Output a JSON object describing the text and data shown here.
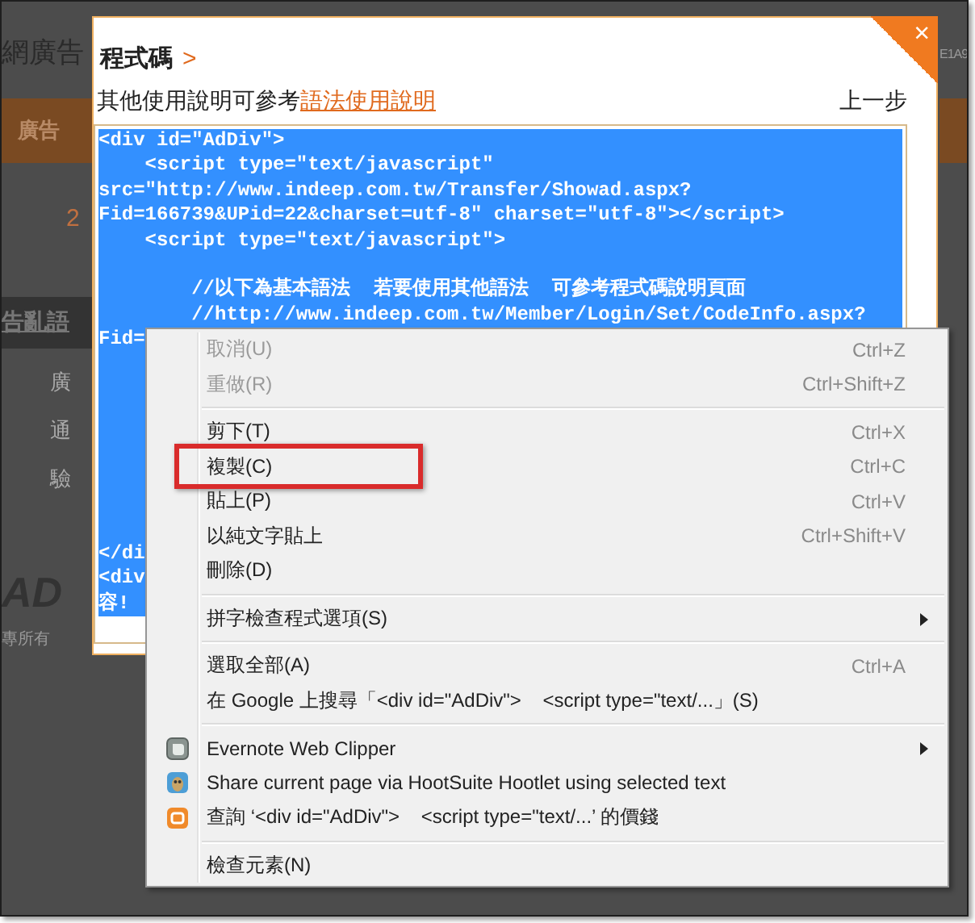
{
  "background_page": {
    "left": [
      {
        "kind": "heading",
        "text": "網廣告"
      },
      {
        "kind": "bar",
        "text": "廣告"
      },
      {
        "kind": "number",
        "text": "2"
      },
      {
        "kind": "tab",
        "text": "告亂語"
      },
      {
        "kind": "item",
        "text": "廣"
      },
      {
        "kind": "item",
        "text": "通"
      },
      {
        "kind": "item",
        "text": "驗"
      },
      {
        "kind": "logo",
        "text": "AD"
      },
      {
        "kind": "footer",
        "text": "專所有"
      }
    ],
    "right": [
      {
        "kind": "heading",
        "text": "E1A9"
      },
      {
        "kind": "bar"
      }
    ]
  },
  "dialog": {
    "title": "程式碼",
    "title_mark": ">",
    "hint": "其他使用說明可參考",
    "hint_link": "語法使用說明",
    "back": "上一步",
    "close": "×",
    "code": {
      "selected": true,
      "blocks": [
        [
          "<div id=\"AdDiv\">",
          "    <script type=\"text/javascript\"",
          "src=\"http://www.indeep.com.tw/Transfer/Showad.aspx?",
          "Fid=166739&UPid=22&charset=utf-8\" charset=\"utf-8\"></script>",
          "    <script type=\"text/javascript\">"
        ],
        [
          "        //以下為基本語法  若要使用其他語法  可參考程式碼說明頁面",
          "        //http://www.indeep.com.tw/Member/Login/Set/CodeInfo.aspx?",
          "Fid="
        ],
        [
          "</di",
          "<div",
          "容!"
        ]
      ]
    }
  },
  "context_menu": {
    "items": [
      {
        "kind": "item",
        "label": "取消(U)",
        "shortcut": "Ctrl+Z",
        "disabled": true
      },
      {
        "kind": "item",
        "label": "重做(R)",
        "shortcut": "Ctrl+Shift+Z",
        "disabled": true
      },
      {
        "kind": "separator"
      },
      {
        "kind": "item",
        "label": "剪下(T)",
        "shortcut": "Ctrl+X",
        "disabled": false
      },
      {
        "kind": "item",
        "label": "複製(C)",
        "shortcut": "Ctrl+C",
        "disabled": false,
        "highlighted": true
      },
      {
        "kind": "item",
        "label": "貼上(P)",
        "shortcut": "Ctrl+V",
        "disabled": false
      },
      {
        "kind": "item",
        "label": "以純文字貼上",
        "shortcut": "Ctrl+Shift+V",
        "disabled": false
      },
      {
        "kind": "item",
        "label": "刪除(D)",
        "disabled": false
      },
      {
        "kind": "separator"
      },
      {
        "kind": "submenu",
        "label": "拼字檢查程式選項(S)"
      },
      {
        "kind": "separator"
      },
      {
        "kind": "item",
        "label": "選取全部(A)",
        "shortcut": "Ctrl+A",
        "disabled": false
      },
      {
        "kind": "item",
        "label": "在 Google 上搜尋「<div id=\"AdDiv\">    <script type=\"text/...」(S)",
        "disabled": false
      },
      {
        "kind": "separator"
      },
      {
        "kind": "extension",
        "label": "Evernote Web Clipper",
        "submenu": true
      },
      {
        "kind": "extension",
        "label": "Share current page via HootSuite Hootlet using selected text",
        "submenu": false
      },
      {
        "kind": "extension",
        "label": "查詢 ‘<div id=\"AdDiv\">    <script type=\"text/...’ 的價錢",
        "submenu": false
      },
      {
        "kind": "separator"
      },
      {
        "kind": "item",
        "label": "檢查元素(N)",
        "disabled": false
      }
    ]
  }
}
